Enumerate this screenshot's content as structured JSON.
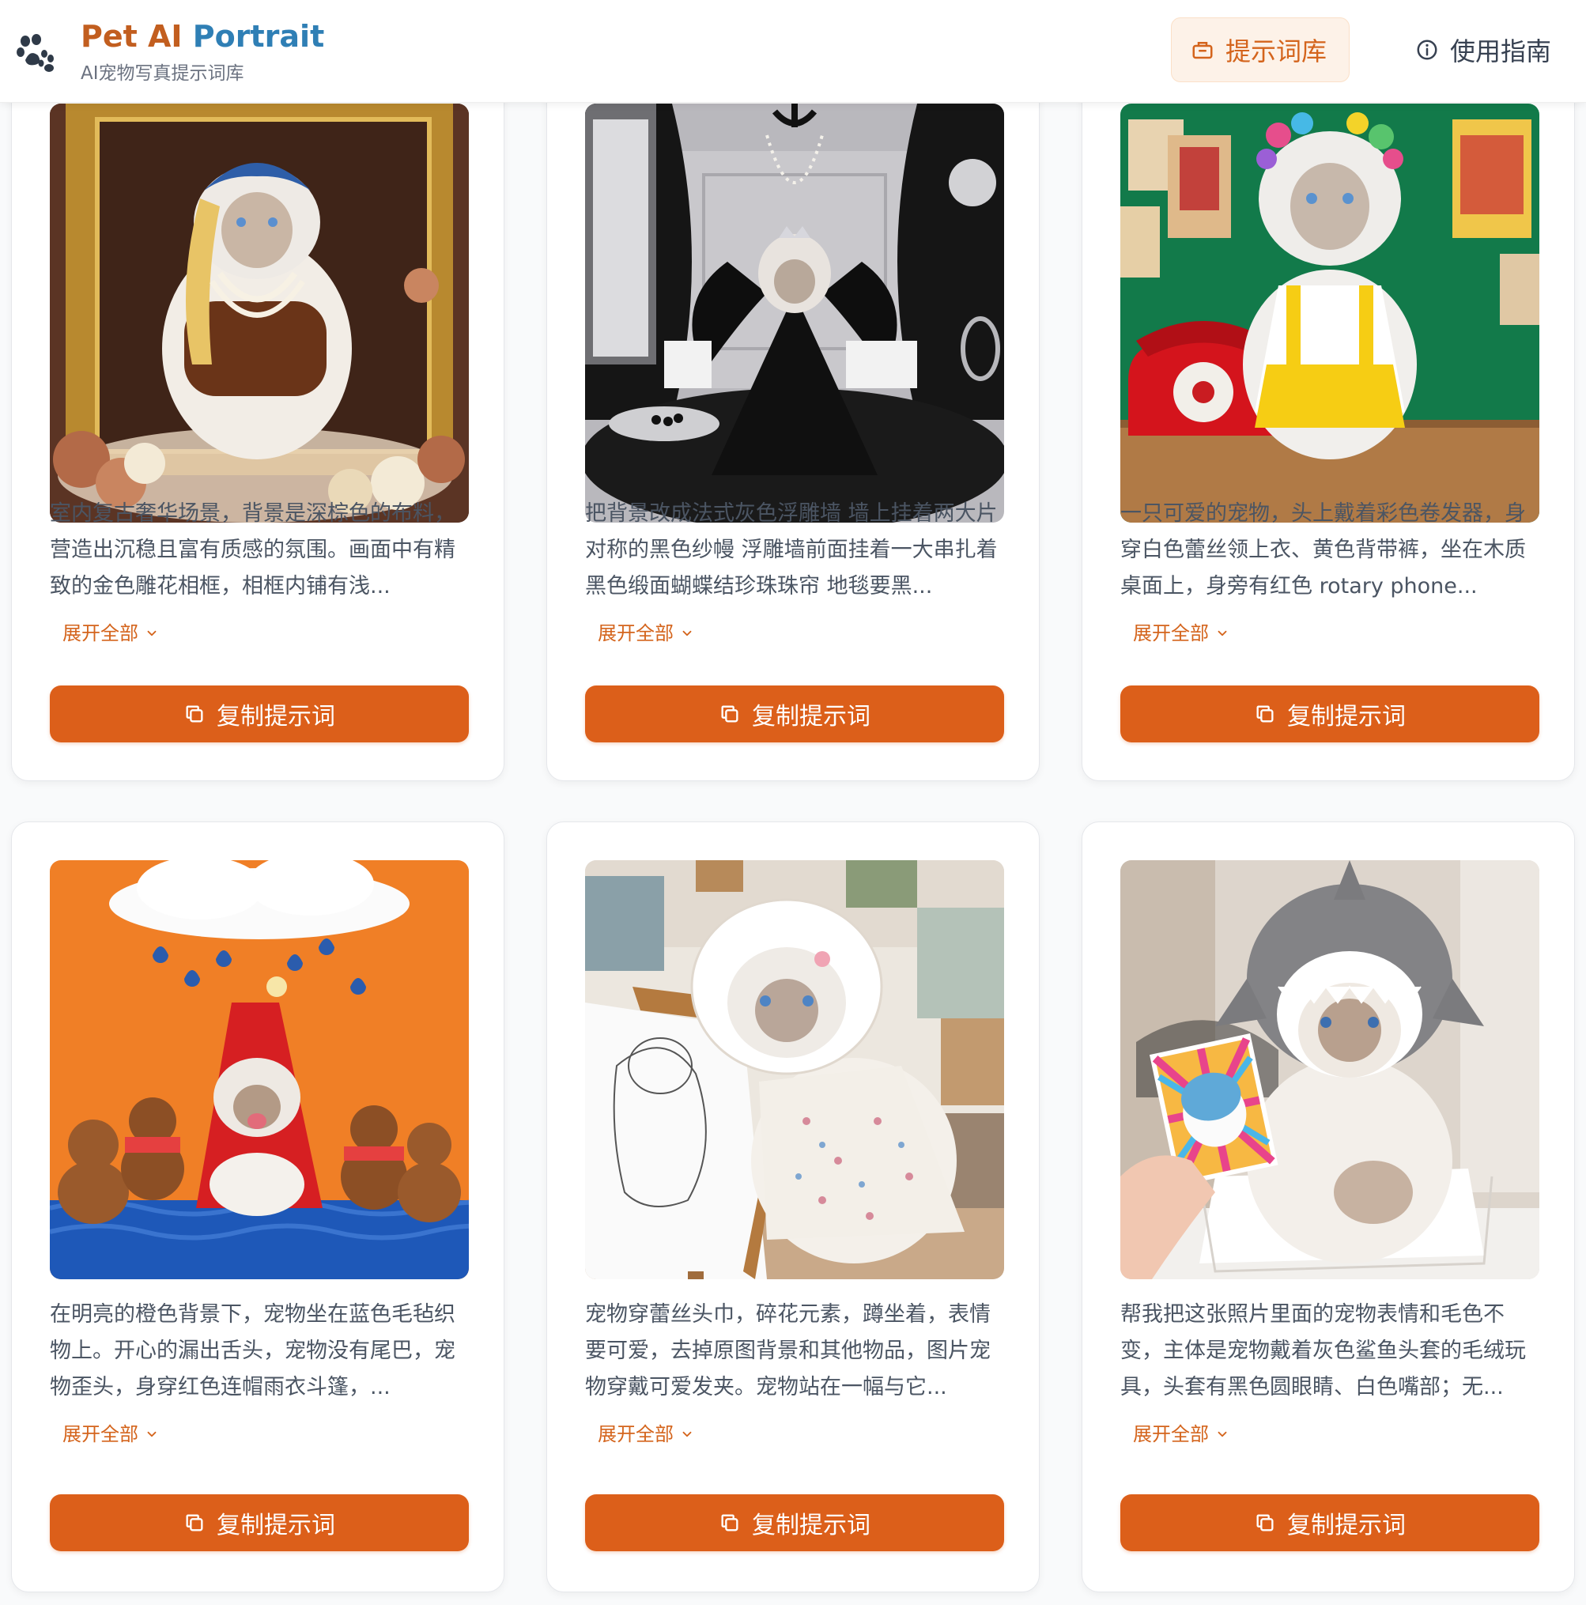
{
  "header": {
    "brand_title_main": "Pet AI ",
    "brand_title_accent": "Portrait",
    "brand_subtitle": "AI宠物写真提示词库",
    "brand_icon": "paw-icon",
    "nav_prompts_label": "提示词库",
    "nav_prompts_icon": "library-icon",
    "nav_guide_label": "使用指南",
    "nav_guide_icon": "info-icon"
  },
  "colors": {
    "accent": "#dc5f1a",
    "accent_text": "#d4641c",
    "brand_blue": "#2f7fb5",
    "nav_active_bg": "#fdf2e8"
  },
  "cards": [
    {
      "image": "ragdoll cat in brown velvet top with pearl necklaces inside a gilded baroque frame with roses",
      "description": "室内复古奢华场景，背景是深棕色的布料，营造出沉稳且富有质感的氛围。画面中有精致的金色雕花相框，相框内铺有浅...",
      "expand_label": "展开全部",
      "copy_label": "复制提示词"
    },
    {
      "image": "ragdoll cat with black feathered wings, tiara and black lace gown before grey carved wall with black curtains",
      "description": "把背景改成法式灰色浮雕墙 墙上挂着两大片对称的黑色纱幔 浮雕墙前面挂着一大串扎着黑色缎面蝴蝶结珍珠珠帘 地毯要黑...",
      "expand_label": "展开全部",
      "copy_label": "复制提示词"
    },
    {
      "image": "ragdoll cat with colorful hair curlers, white lace blouse and yellow overalls on wooden desk beside red rotary phone",
      "description": "一只可爱的宠物，头上戴着彩色卷发器，身穿白色蕾丝领上衣、黄色背带裤，坐在木质桌面上，身旁有红色 rotary phone...",
      "expand_label": "展开全部",
      "copy_label": "复制提示词"
    },
    {
      "image": "happy cat in red hooded cape on blue knit blanket with teddy bears under a felt rain cloud on orange background",
      "description": "在明亮的橙色背景下，宠物坐在蓝色毛毡织物上。开心的漏出舌头，宠物没有尾巴，宠物歪头，身穿红色连帽雨衣斗篷，...",
      "expand_label": "展开全部",
      "copy_label": "复制提示词"
    },
    {
      "image": "ragdoll cat in lace bonnet and floral dress beside an easel with a pencil sketch of a cat",
      "description": "宠物穿蕾丝头巾，碎花元素，蹲坐着，表情要可爱，去掉原图背景和其他物品，图片宠物穿戴可爱发夹。宠物站在一幅与它...",
      "expand_label": "展开全部",
      "copy_label": "复制提示词"
    },
    {
      "image": "ragdoll cat wearing grey plush shark hat sitting in a white box, hand holding a rainbow sticker card",
      "description": "帮我把这张照片里面的宠物表情和毛色不变，主体是宠物戴着灰色鲨鱼头套的毛绒玩具，头套有黑色圆眼睛、白色嘴部；无...",
      "expand_label": "展开全部",
      "copy_label": "复制提示词"
    }
  ]
}
